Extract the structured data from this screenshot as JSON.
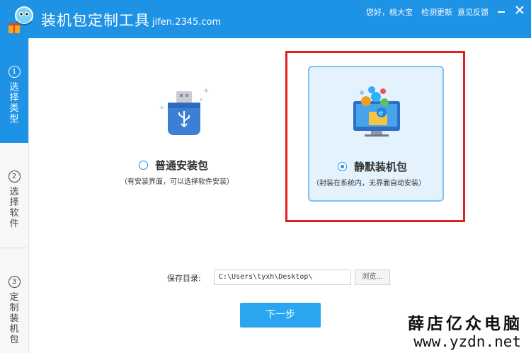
{
  "header": {
    "title": "装机包定制工具",
    "subtitle": "jifen.2345.com",
    "greeting": "您好，桃大宝",
    "check_update": "检测更新",
    "feedback": "意见反馈",
    "minimize_icon": "minimize-icon",
    "close_icon": "close-icon"
  },
  "sidebar": {
    "steps": [
      {
        "num": "①",
        "label": "选择类型",
        "active": true
      },
      {
        "num": "②",
        "label": "选择软件",
        "active": false
      },
      {
        "num": "③",
        "label": "定制装机包",
        "active": false
      }
    ]
  },
  "options": {
    "normal": {
      "title": "普通安装包",
      "desc": "（有安装界面，可以选择软件安装）",
      "selected": false,
      "icon": "usb-drive-icon"
    },
    "silent": {
      "title": "静默装机包",
      "desc": "（封装在系统内，无界面自动安装）",
      "selected": true,
      "icon": "monitor-apps-icon"
    }
  },
  "save": {
    "label": "保存目录:",
    "path": "C:\\Users\\tyxh\\Desktop\\",
    "browse": "浏览..."
  },
  "next_button": "下一步",
  "watermark": {
    "cn": "薛店亿众电脑",
    "url": "www.yzdn.net"
  },
  "colors": {
    "accent": "#1e93e6",
    "button": "#2aa6f1",
    "selected_card_bg": "#e3f2fd",
    "highlight": "#e02020"
  }
}
